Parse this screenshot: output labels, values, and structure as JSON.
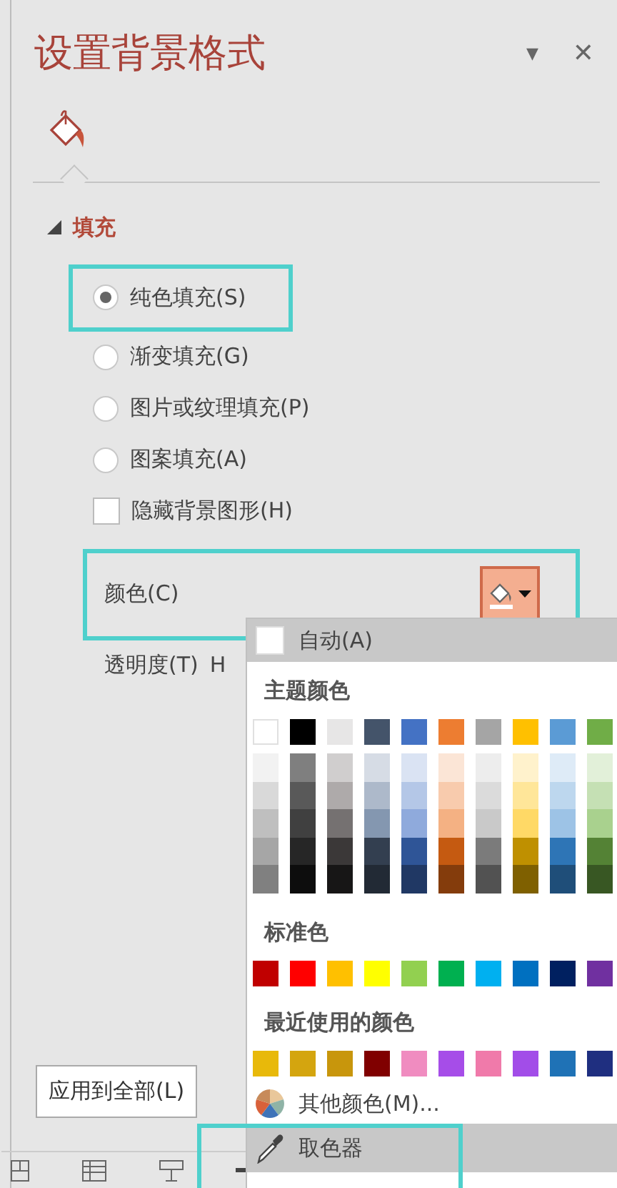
{
  "panel": {
    "title": "设置背景格式",
    "menu_glyph": "▼",
    "close_glyph": "✕"
  },
  "section": {
    "title": "填充",
    "expanded": true
  },
  "fill_options": [
    {
      "kind": "radio",
      "label": "纯色填充(S)",
      "selected": true,
      "annotated": true
    },
    {
      "kind": "radio",
      "label": "渐变填充(G)",
      "selected": false,
      "annotated": false
    },
    {
      "kind": "radio",
      "label": "图片或纹理填充(P)",
      "selected": false,
      "annotated": false
    },
    {
      "kind": "radio",
      "label": "图案填充(A)",
      "selected": false,
      "annotated": false
    },
    {
      "kind": "checkbox",
      "label": "隐藏背景图形(H)",
      "checked": false,
      "annotated": false
    }
  ],
  "color_row": {
    "label": "颜色(C)",
    "annotated": true,
    "expanded": true
  },
  "transparency": {
    "label": "透明度(T)",
    "value": "H"
  },
  "apply_button": "应用到全部(L)",
  "color_menu": {
    "auto": {
      "label": "自动(A)",
      "selected": true
    },
    "theme_heading": "主题颜色",
    "theme": [
      {
        "color": "#ffffff",
        "shades": [
          {
            "color": "#f2f2f2"
          },
          {
            "color": "#d9d9d9"
          },
          {
            "color": "#bfbfbf"
          },
          {
            "color": "#a6a6a6"
          },
          {
            "color": "#808080"
          }
        ]
      },
      {
        "color": "#000000",
        "shades": [
          {
            "color": "#7f7f7f"
          },
          {
            "color": "#595959"
          },
          {
            "color": "#404040"
          },
          {
            "color": "#262626"
          },
          {
            "color": "#0d0d0d"
          }
        ]
      },
      {
        "color": "#e7e6e6",
        "shades": [
          {
            "color": "#d0cece"
          },
          {
            "color": "#aeaaaa"
          },
          {
            "color": "#757171"
          },
          {
            "color": "#3b3838"
          },
          {
            "color": "#171616"
          }
        ]
      },
      {
        "color": "#44546a",
        "shades": [
          {
            "color": "#d6dce5"
          },
          {
            "color": "#adb9ca"
          },
          {
            "color": "#8497b0"
          },
          {
            "color": "#333f50"
          },
          {
            "color": "#222a35"
          }
        ]
      },
      {
        "color": "#4472c4",
        "shades": [
          {
            "color": "#dae3f3"
          },
          {
            "color": "#b4c7e7"
          },
          {
            "color": "#8faadc"
          },
          {
            "color": "#2f5597"
          },
          {
            "color": "#203864"
          }
        ]
      },
      {
        "color": "#ed7d31",
        "shades": [
          {
            "color": "#fbe5d6"
          },
          {
            "color": "#f8cbad"
          },
          {
            "color": "#f4b183"
          },
          {
            "color": "#c55a11"
          },
          {
            "color": "#843c0c"
          }
        ]
      },
      {
        "color": "#a5a5a5",
        "shades": [
          {
            "color": "#ededed"
          },
          {
            "color": "#dbdbdb"
          },
          {
            "color": "#c9c9c9"
          },
          {
            "color": "#7b7b7b"
          },
          {
            "color": "#525252"
          }
        ]
      },
      {
        "color": "#ffc000",
        "shades": [
          {
            "color": "#fff2cc"
          },
          {
            "color": "#ffe699"
          },
          {
            "color": "#ffd966"
          },
          {
            "color": "#bf9000"
          },
          {
            "color": "#7f6000"
          }
        ]
      },
      {
        "color": "#5b9bd5",
        "shades": [
          {
            "color": "#deebf7"
          },
          {
            "color": "#bdd7ee"
          },
          {
            "color": "#9dc3e6"
          },
          {
            "color": "#2e75b6"
          },
          {
            "color": "#1f4e79"
          }
        ]
      },
      {
        "color": "#70ad47",
        "shades": [
          {
            "color": "#e2f0d9"
          },
          {
            "color": "#c5e0b4"
          },
          {
            "color": "#a9d18e"
          },
          {
            "color": "#548235"
          },
          {
            "color": "#385723"
          }
        ]
      }
    ],
    "standard_heading": "标准色",
    "standard": [
      {
        "color": "#c00000"
      },
      {
        "color": "#ff0000"
      },
      {
        "color": "#ffc000"
      },
      {
        "color": "#ffff00"
      },
      {
        "color": "#92d050"
      },
      {
        "color": "#00b050"
      },
      {
        "color": "#00b0f0"
      },
      {
        "color": "#0070c0"
      },
      {
        "color": "#002060"
      },
      {
        "color": "#7030a0"
      }
    ],
    "recent_heading": "最近使用的颜色",
    "recent": [
      {
        "color": "#e8b90a"
      },
      {
        "color": "#d4a50f"
      },
      {
        "color": "#c8960c"
      },
      {
        "color": "#800000"
      },
      {
        "color": "#f08cc0"
      },
      {
        "color": "#a64de8"
      },
      {
        "color": "#f07aaa"
      },
      {
        "color": "#a24de8"
      },
      {
        "color": "#1f72b6"
      },
      {
        "color": "#1f2f80"
      }
    ],
    "more_colors": "其他颜色(M)...",
    "eyedropper": {
      "label": "取色器",
      "selected": true,
      "annotated": true
    }
  }
}
